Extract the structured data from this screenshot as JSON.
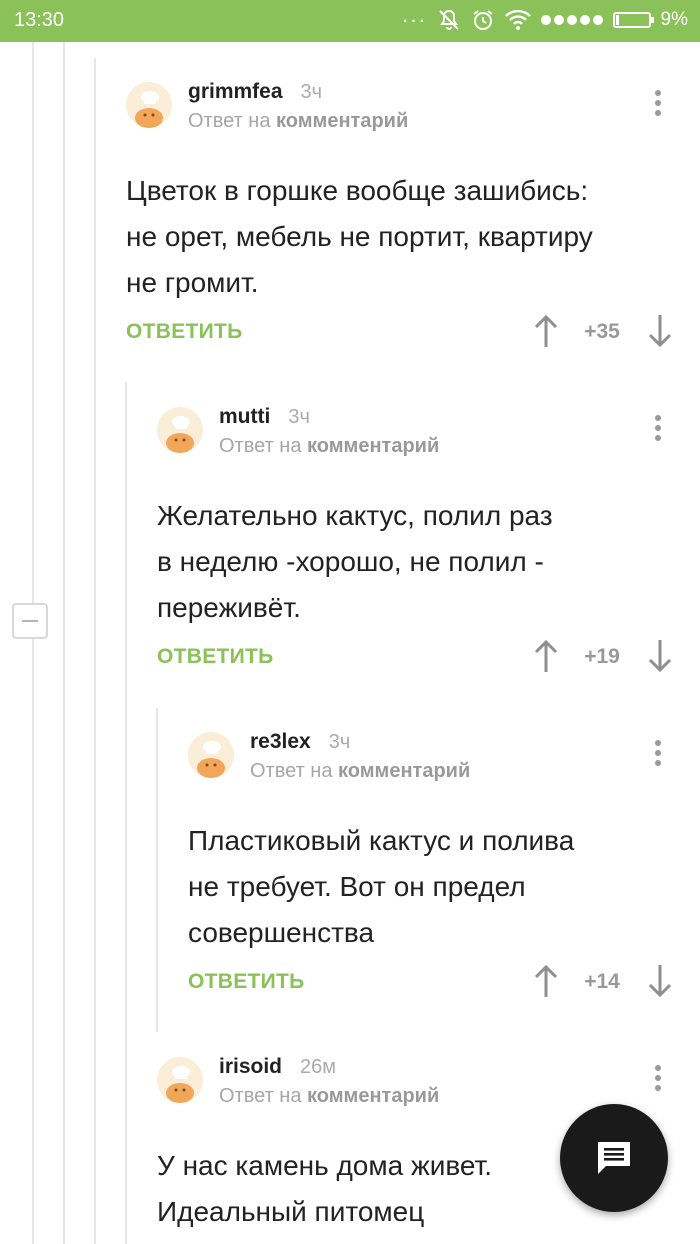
{
  "status_bar": {
    "time": "13:30",
    "battery_percent": "9%",
    "icons": [
      "dots-icon",
      "mute-icon",
      "alarm-icon",
      "wifi-icon",
      "signal-icon",
      "battery-icon"
    ]
  },
  "comments": [
    {
      "author": "grimmfea",
      "time": "3ч",
      "reply_to_prefix": "Ответ на",
      "reply_to_link": "комментарий",
      "text_lines": [
        "Цветок в горшке вообще зашибись:",
        "не орет, мебель не портит, квартиру",
        "не громит."
      ],
      "reply_label": "ОТВЕТИТЬ",
      "rating": "+35"
    },
    {
      "author": "mutti",
      "time": "3ч",
      "reply_to_prefix": "Ответ на",
      "reply_to_link": "комментарий",
      "text_lines": [
        "Желательно кактус, полил раз",
        "в неделю -хорошо, не полил -",
        "переживёт."
      ],
      "reply_label": "ОТВЕТИТЬ",
      "rating": "+19"
    },
    {
      "author": "re3lex",
      "time": "3ч",
      "reply_to_prefix": "Ответ на",
      "reply_to_link": "комментарий",
      "text_lines": [
        "Пластиковый кактус и полива",
        "не требует. Вот он предел",
        "совершенства"
      ],
      "reply_label": "ОТВЕТИТЬ",
      "rating": "+14"
    },
    {
      "author": "irisoid",
      "time": "26м",
      "reply_to_prefix": "Ответ на",
      "reply_to_link": "комментарий",
      "text_lines": [
        "У нас камень дома живет.",
        "Идеальный питомец"
      ]
    }
  ],
  "colors": {
    "accent": "#8ac159",
    "fab": "#1a1a1a",
    "meta": "#a6a6a6"
  }
}
